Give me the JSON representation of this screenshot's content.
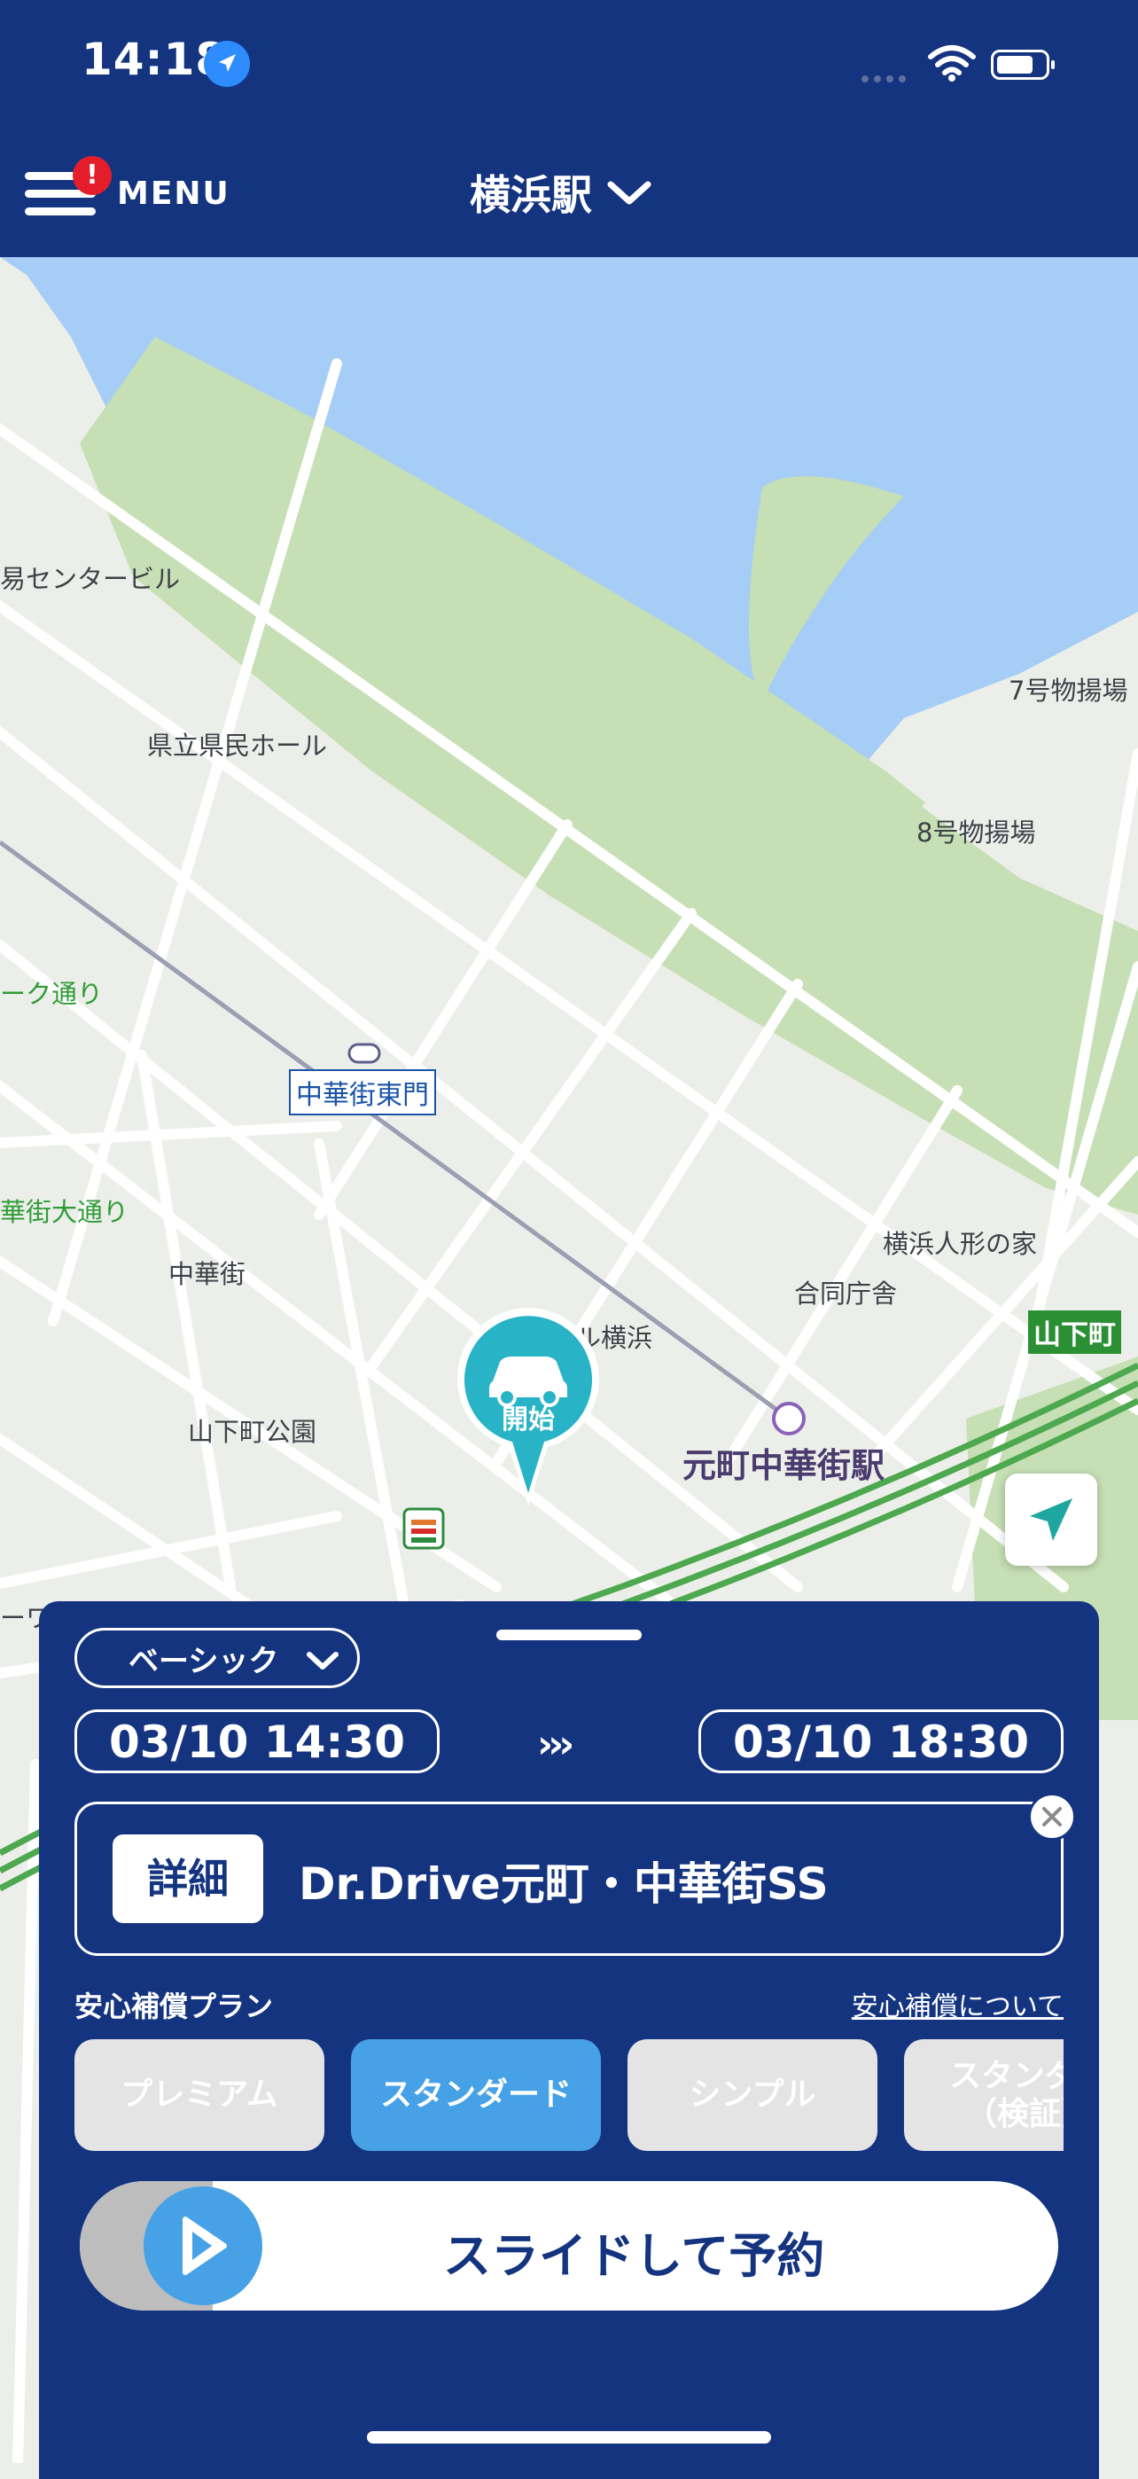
{
  "status_bar": {
    "time": "14:18"
  },
  "header": {
    "menu_label": "MENU",
    "menu_badge": "!",
    "station_selector": "横浜駅"
  },
  "map": {
    "labels": {
      "center_building_left": "易センタービル",
      "kenmin_hall": "県立県民ホール",
      "pier7": "7号物揚場",
      "pier8": "8号物揚場",
      "park_street": "ーク通り",
      "chinatown_east_gate": "中華街東門",
      "chinatown_main_street": "華街大通り",
      "chinatown": "中華街",
      "escal": "エスカル横浜",
      "yamashita_park": "山下町公園",
      "doll_house": "横浜人形の家",
      "joint_office": "合同庁舎",
      "yamashita_exit": "山下町",
      "motomachi_station": "元町中華街駅",
      "left_edge": "ーワー"
    },
    "pin_label": "開始"
  },
  "sheet": {
    "plan_type": "ベーシック",
    "start_datetime": "03/10 14:30",
    "end_datetime": "03/10 18:30",
    "detail_button": "詳細",
    "station_name": "Dr.Drive元町・中華街SS",
    "insurance_title": "安心補償プラン",
    "insurance_link": "安心補償について",
    "insurance_plans": [
      {
        "label": "プレミアム",
        "active": false
      },
      {
        "label": "スタンダード",
        "active": true
      },
      {
        "label": "シンプル",
        "active": false
      },
      {
        "label": "スタンダー\n（検証）",
        "active": false
      }
    ],
    "slide_label": "スライドして予約"
  },
  "colors": {
    "header_bg": "#143480",
    "accent_blue": "#47a1e6",
    "pin_teal": "#28b3c6",
    "water": "#a6cdf6",
    "park": "#c6dfb4"
  }
}
